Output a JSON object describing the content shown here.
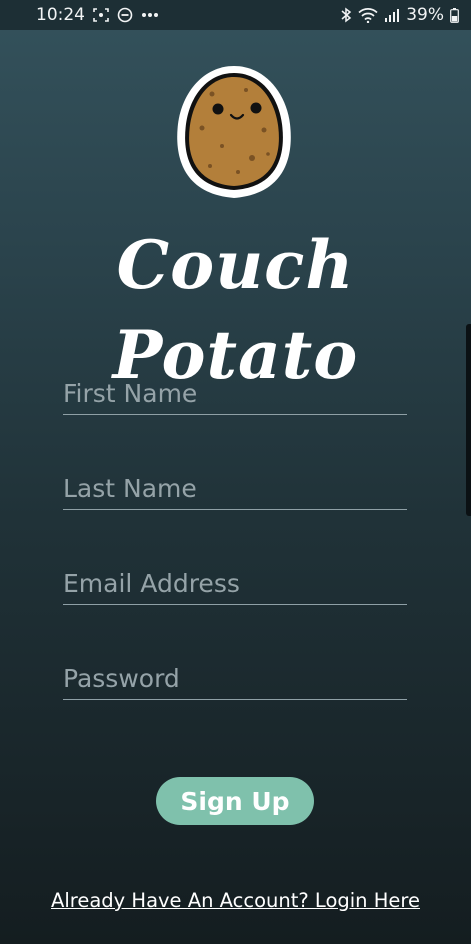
{
  "status_bar": {
    "time": "10:24",
    "battery": "39%",
    "left_icons": [
      "screenshot-icon",
      "do-not-disturb-icon",
      "more-dots-icon"
    ],
    "right_icons": [
      "bluetooth-icon",
      "wifi-icon",
      "signal-icon",
      "battery-icon"
    ]
  },
  "app": {
    "title": "Couch Potato",
    "logo": "potato-mascot"
  },
  "form": {
    "first_name_placeholder": "First Name",
    "last_name_placeholder": "Last Name",
    "email_placeholder": "Email Address",
    "password_placeholder": "Password",
    "submit_label": "Sign Up"
  },
  "footer": {
    "login_link": "Already Have An Account? Login Here"
  },
  "colors": {
    "background_top": "#34525c",
    "background_bottom": "#141d20",
    "button": "#7fc1ac",
    "potato": "#b37f3a"
  }
}
